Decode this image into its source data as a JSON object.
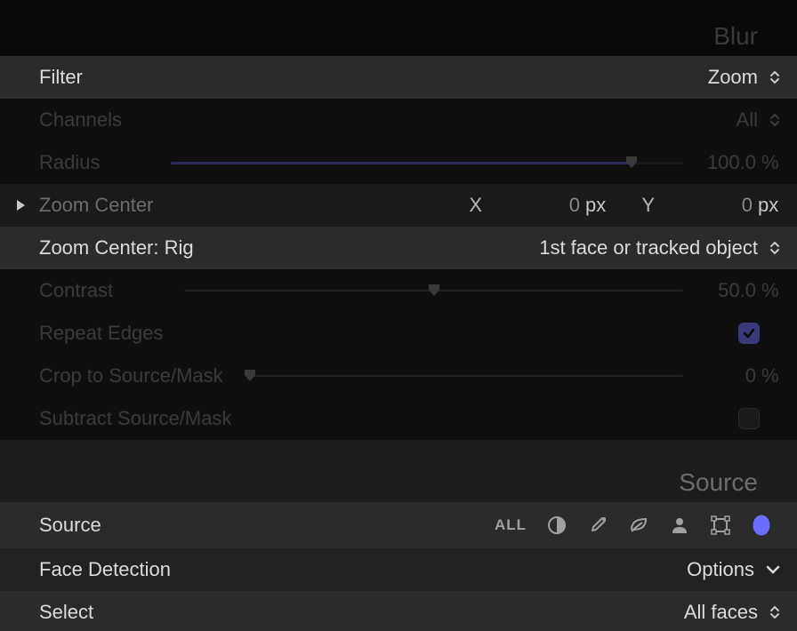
{
  "sections": {
    "blur": "Blur",
    "source": "Source"
  },
  "filter": {
    "label": "Filter",
    "value": "Zoom"
  },
  "channels": {
    "label": "Channels",
    "value": "All"
  },
  "radius": {
    "label": "Radius",
    "value": "100.0",
    "unit": "%",
    "fill_pct": 90
  },
  "zoomCenter": {
    "label": "Zoom Center",
    "x_label": "X",
    "x_value": "0",
    "x_unit": "px",
    "y_label": "Y",
    "y_value": "0",
    "y_unit": "px"
  },
  "zoomCenterRig": {
    "label": "Zoom Center: Rig",
    "value": "1st face or tracked object"
  },
  "contrast": {
    "label": "Contrast",
    "value": "50.0",
    "unit": "%",
    "fill_pct": 50
  },
  "repeatEdges": {
    "label": "Repeat Edges",
    "checked": true
  },
  "cropToSource": {
    "label": "Crop to Source/Mask",
    "value": "0",
    "unit": "%",
    "fill_pct": 0
  },
  "subtractSource": {
    "label": "Subtract Source/Mask",
    "checked": false
  },
  "sourceRow": {
    "label": "Source",
    "all": "ALL"
  },
  "faceDetection": {
    "label": "Face Detection",
    "value": "Options"
  },
  "select": {
    "label": "Select",
    "value": "All faces"
  }
}
